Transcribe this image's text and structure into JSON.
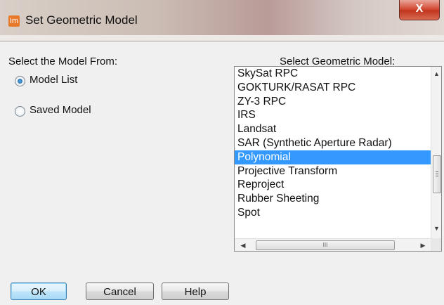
{
  "window": {
    "title": "Set Geometric Model",
    "app_icon_text": "Im",
    "close_label": "X"
  },
  "source": {
    "label": "Select the Model From:",
    "options": [
      {
        "label": "Model List",
        "checked": true
      },
      {
        "label": "Saved Model",
        "checked": false
      }
    ]
  },
  "model_list": {
    "label": "Select Geometric Model:",
    "items": [
      "SkySat RPC",
      "GOKTURK/RASAT RPC",
      "ZY-3 RPC",
      "IRS",
      "Landsat",
      "SAR (Synthetic Aperture Radar)",
      "Polynomial",
      "Projective Transform",
      "Reproject",
      "Rubber Sheeting",
      "Spot"
    ],
    "selected": "Polynomial",
    "hscroll_grip": "III"
  },
  "buttons": {
    "ok": "OK",
    "cancel": "Cancel",
    "help": "Help"
  },
  "colors": {
    "selection": "#3399ff",
    "title_bar": "#cbbdb4",
    "close_button": "#c2351f"
  }
}
